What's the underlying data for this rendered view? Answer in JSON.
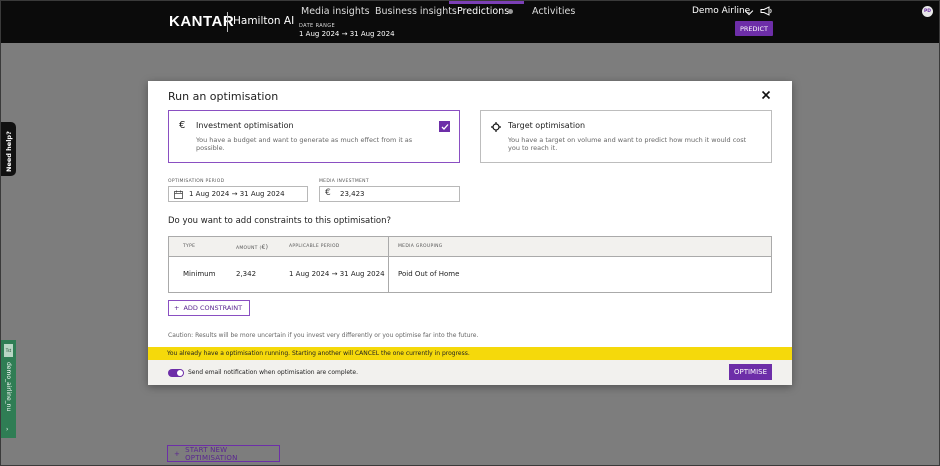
{
  "header": {
    "logo": "KANTAR",
    "product": "Hamilton AI",
    "date_range_label": "DATE RANGE",
    "date_range_value": "1 Aug 2024 → 31 Aug 2024",
    "nav": [
      "Media insights",
      "Business insights",
      "Predictions",
      "Activities"
    ],
    "active_nav": "Predictions",
    "account": "Demo Airline",
    "predict_label": "PREDICT",
    "avatar_initials": "PD"
  },
  "side": {
    "need_help": "Need help?",
    "env_badge": "Tst",
    "env_name": "demo_airline_nu",
    "env_arrow": "›"
  },
  "background": {
    "start_new_label": "START NEW OPTIMISATION"
  },
  "modal": {
    "title": "Run an optimisation",
    "cards": [
      {
        "title": "Investment optimisation",
        "desc": "You have a budget and want to generate as much effect from it as possible.",
        "icon": "€",
        "selected": true
      },
      {
        "title": "Target optimisation",
        "desc": "You have a target on volume and want to predict how much it would cost you to reach it.",
        "icon": "⌖",
        "selected": false
      }
    ],
    "period_label": "OPTIMISATION PERIOD",
    "period_value": "1 Aug 2024 → 31 Aug 2024",
    "investment_label": "MEDIA INVESTMENT",
    "investment_value": "23,423",
    "question": "Do you want to add constraints to this optimisation?",
    "table": {
      "headers": [
        "TYPE",
        "AMOUNT (",
        "APPLICABLE PERIOD",
        "MEDIA GROUPING"
      ],
      "rows": [
        {
          "type": "Minimum",
          "amount": "2,342",
          "period": "1 Aug 2024 → 31 Aug 2024",
          "grouping": "Poid Out of Home"
        }
      ]
    },
    "add_constraint_label": "ADD CONSTRAINT",
    "caution": "Caution: Results will be more uncertain if you invest very differently or you optimise far into the future.",
    "warning": "You already have a optimisation running. Starting another will CANCEL the one currently in progress.",
    "email_label": "Send email notification when optimisation are complete.",
    "optimise_label": "OPTIMISE"
  },
  "colors": {
    "brand_purple": "#6d2ea8",
    "warning_yellow": "#f5d90b",
    "topbar": "#0b0b0b",
    "env_green": "#2f7d54"
  }
}
